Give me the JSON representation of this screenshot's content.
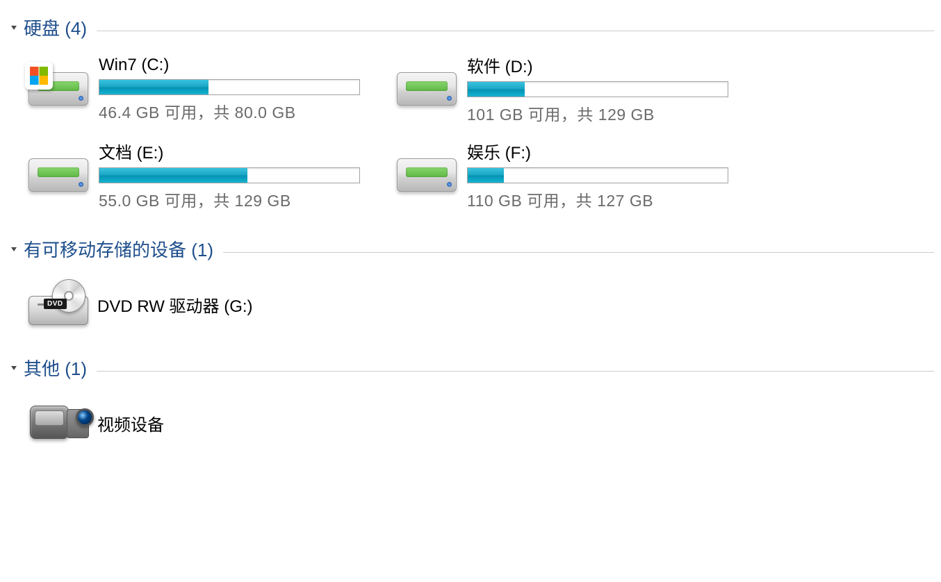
{
  "sections": {
    "hdd": {
      "title": "硬盘 (4)",
      "drives": [
        {
          "name": "Win7 (C:)",
          "status": "46.4 GB 可用，共 80.0 GB",
          "used_pct": 42,
          "is_os": true
        },
        {
          "name": "软件 (D:)",
          "status": "101 GB 可用，共 129 GB",
          "used_pct": 22,
          "is_os": false
        },
        {
          "name": "文档 (E:)",
          "status": "55.0 GB 可用，共 129 GB",
          "used_pct": 57,
          "is_os": false
        },
        {
          "name": "娱乐 (F:)",
          "status": "110 GB 可用，共 127 GB",
          "used_pct": 14,
          "is_os": false
        }
      ]
    },
    "removable": {
      "title": "有可移动存储的设备 (1)",
      "dvd_label": "DVD",
      "items": [
        {
          "name": "DVD RW 驱动器 (G:)"
        }
      ]
    },
    "other": {
      "title": "其他 (1)",
      "items": [
        {
          "name": "视频设备"
        }
      ]
    }
  }
}
